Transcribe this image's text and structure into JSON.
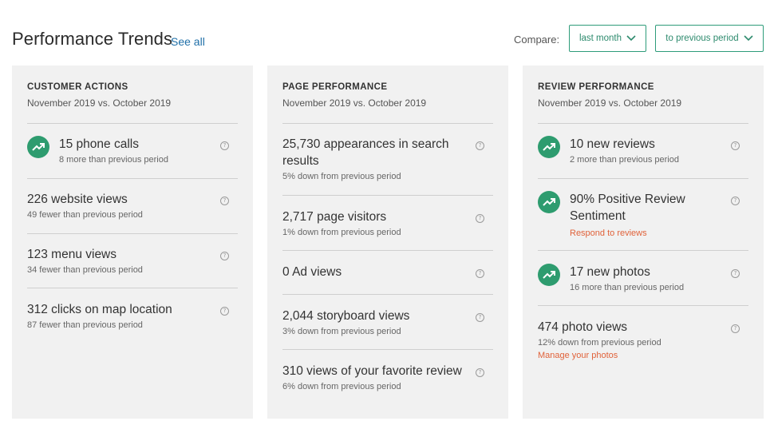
{
  "header": {
    "title": "Performance Trends",
    "see_all": "See all",
    "compare_label": "Compare:",
    "period_select": "last month",
    "compare_select": "to previous period"
  },
  "colors": {
    "accent": "#2e9c6f",
    "link": "#1f6fa8",
    "alert": "#e0623a",
    "card_bg": "#f1f1f1"
  },
  "icons": {
    "trend": "trending-up-icon",
    "help": "help-circle-icon",
    "chevron": "chevron-down-icon"
  },
  "cards": [
    {
      "title": "CUSTOMER ACTIONS",
      "subtitle": "November 2019 vs. October 2019",
      "metrics": [
        {
          "main": "15 phone calls",
          "sub": "8 more than previous period",
          "trend_up": true
        },
        {
          "main": "226 website views",
          "sub": "49 fewer than previous period",
          "trend_up": false
        },
        {
          "main": "123 menu views",
          "sub": "34 fewer than previous period",
          "trend_up": false
        },
        {
          "main": "312 clicks on map location",
          "sub": "87 fewer than previous period",
          "trend_up": false
        }
      ]
    },
    {
      "title": "PAGE PERFORMANCE",
      "subtitle": "November 2019 vs. October 2019",
      "metrics": [
        {
          "main": "25,730 appearances in search results",
          "sub": "5% down from previous period",
          "trend_up": false
        },
        {
          "main": "2,717 page visitors",
          "sub": "1% down from previous period",
          "trend_up": false
        },
        {
          "main": "0 Ad views",
          "sub": "",
          "trend_up": false
        },
        {
          "main": "2,044 storyboard views",
          "sub": "3% down from previous period",
          "trend_up": false
        },
        {
          "main": "310 views of your favorite review",
          "sub": "6% down from previous period",
          "trend_up": false
        }
      ]
    },
    {
      "title": "REVIEW PERFORMANCE",
      "subtitle": "November 2019 vs. October 2019",
      "metrics": [
        {
          "main": "10 new reviews",
          "sub": "2 more than previous period",
          "trend_up": true
        },
        {
          "main": "90% Positive Review Sentiment",
          "sub": "",
          "link": "Respond to reviews",
          "trend_up": true
        },
        {
          "main": "17 new photos",
          "sub": "16 more than previous period",
          "trend_up": true
        },
        {
          "main": "474 photo views",
          "sub": "12% down from previous period",
          "link": "Manage your photos",
          "trend_up": false
        }
      ]
    }
  ]
}
